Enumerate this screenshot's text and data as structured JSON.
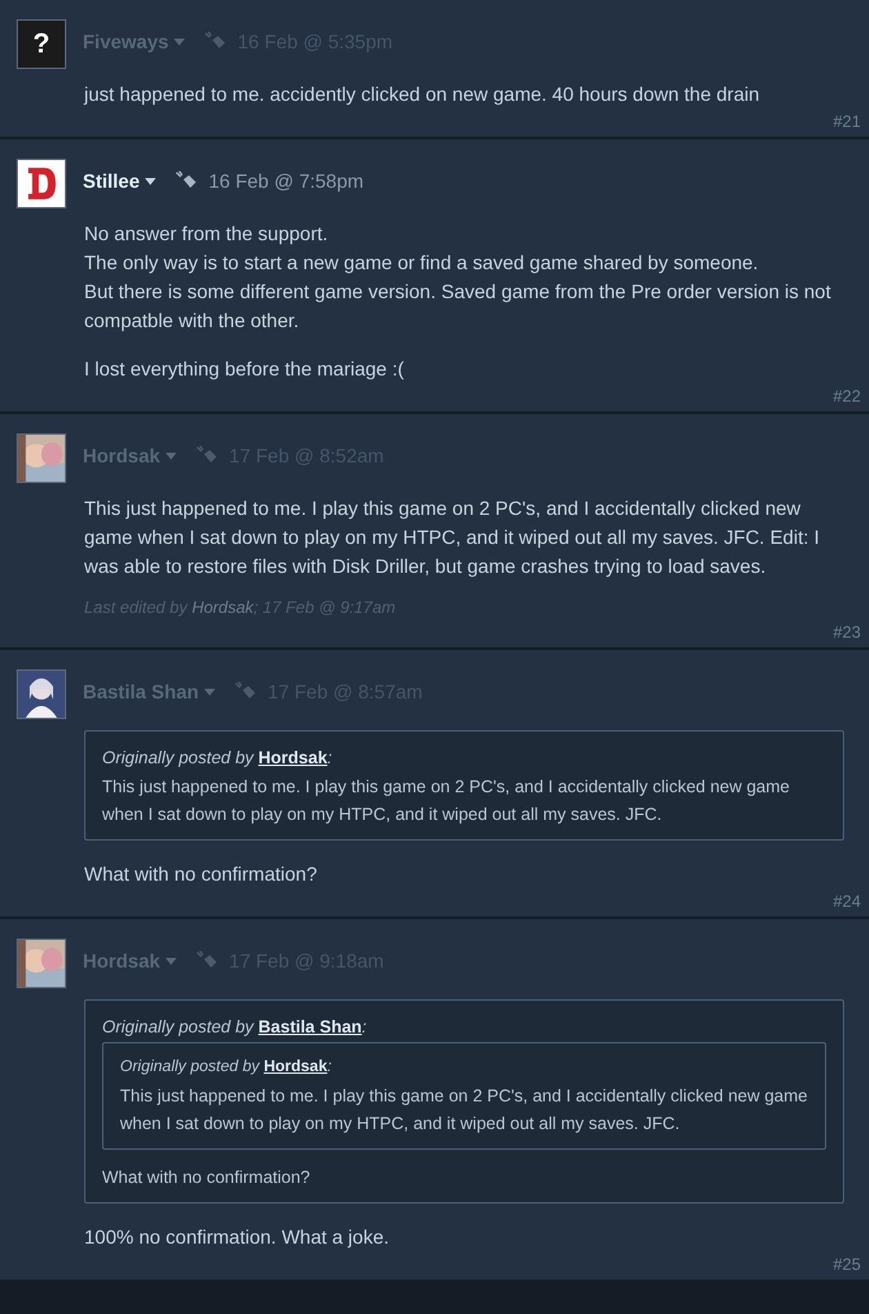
{
  "posts": [
    {
      "author": "Fiveways",
      "online": false,
      "avatar": {
        "kind": "glyph",
        "text": "?"
      },
      "timestamp": "16 Feb @ 5:35pm",
      "body": [
        {
          "kind": "text",
          "lines": [
            "just happened to me. accidently clicked on new game. 40 hours down the drain"
          ]
        }
      ],
      "number": "#21"
    },
    {
      "author": "Stillee",
      "online": true,
      "avatar": {
        "kind": "logo"
      },
      "timestamp": "16 Feb @ 7:58pm",
      "body": [
        {
          "kind": "text",
          "lines": [
            "No answer from the support.",
            "The only way is to start a new game or find a saved game shared by someone.",
            "But there is some different game version. Saved game from the Pre order version is not compatble with the other."
          ]
        },
        {
          "kind": "text",
          "lines": [
            "I lost everything before the mariage :("
          ]
        }
      ],
      "number": "#22"
    },
    {
      "author": "Hordsak",
      "online": false,
      "avatar": {
        "kind": "picture"
      },
      "timestamp": "17 Feb @ 8:52am",
      "body": [
        {
          "kind": "text",
          "lines": [
            "This just happened to me. I play this game on 2 PC's, and I accidentally clicked new game when I sat down to play on my HTPC, and it wiped out all my saves. JFC. Edit: I was able to restore files with Disk Driller, but game crashes trying to load saves."
          ]
        }
      ],
      "edited": {
        "prefix": "Last edited by",
        "by": "Hordsak",
        "when": "; 17 Feb @ 9:17am"
      },
      "number": "#23"
    },
    {
      "author": "Bastila Shan",
      "online": false,
      "avatar": {
        "kind": "figure"
      },
      "timestamp": "17 Feb @ 8:57am",
      "body": [
        {
          "kind": "quote",
          "prefix": "Originally posted by",
          "by": "Hordsak",
          "suffix": ":",
          "body": [
            {
              "kind": "text",
              "lines": [
                "This just happened to me. I play this game on 2 PC's, and I accidentally clicked new game when I sat down to play on my HTPC, and it wiped out all my saves. JFC."
              ]
            }
          ]
        },
        {
          "kind": "text",
          "lines": [
            "What with no confirmation?"
          ]
        }
      ],
      "number": "#24"
    },
    {
      "author": "Hordsak",
      "online": false,
      "avatar": {
        "kind": "picture"
      },
      "timestamp": "17 Feb @ 9:18am",
      "body": [
        {
          "kind": "quote",
          "prefix": "Originally posted by",
          "by": "Bastila Shan",
          "suffix": ":",
          "body": [
            {
              "kind": "quote",
              "prefix": "Originally posted by",
              "by": "Hordsak",
              "suffix": ":",
              "body": [
                {
                  "kind": "text",
                  "lines": [
                    "This just happened to me. I play this game on 2 PC's, and I accidentally clicked new game when I sat down to play on my HTPC, and it wiped out all my saves. JFC."
                  ]
                }
              ]
            },
            {
              "kind": "text",
              "lines": [
                "What with no confirmation?"
              ]
            }
          ]
        },
        {
          "kind": "text",
          "lines": [
            "100% no confirmation. What a joke."
          ]
        }
      ],
      "number": "#25"
    }
  ]
}
